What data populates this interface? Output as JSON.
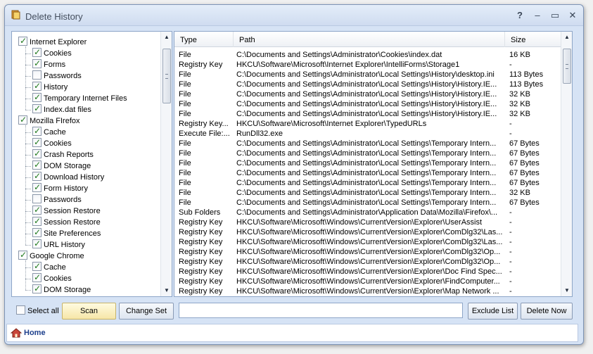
{
  "window": {
    "title": "Delete History"
  },
  "tree": [
    {
      "label": "Internet Explorer",
      "checked": true,
      "level": 0
    },
    {
      "label": "Cookies",
      "checked": true,
      "level": 1
    },
    {
      "label": "Forms",
      "checked": true,
      "level": 1
    },
    {
      "label": "Passwords",
      "checked": false,
      "level": 1
    },
    {
      "label": "History",
      "checked": true,
      "level": 1
    },
    {
      "label": "Temporary Internet Files",
      "checked": true,
      "level": 1
    },
    {
      "label": "Index.dat files",
      "checked": true,
      "level": 1
    },
    {
      "label": "Mozilla FIrefox",
      "checked": true,
      "level": 0
    },
    {
      "label": "Cache",
      "checked": true,
      "level": 1
    },
    {
      "label": "Cookies",
      "checked": true,
      "level": 1
    },
    {
      "label": "Crash Reports",
      "checked": true,
      "level": 1
    },
    {
      "label": "DOM Storage",
      "checked": true,
      "level": 1
    },
    {
      "label": "Download History",
      "checked": true,
      "level": 1
    },
    {
      "label": "Form History",
      "checked": true,
      "level": 1
    },
    {
      "label": "Passwords",
      "checked": false,
      "level": 1
    },
    {
      "label": "Session Restore",
      "checked": true,
      "level": 1
    },
    {
      "label": "Session Restore",
      "checked": true,
      "level": 1
    },
    {
      "label": "Site Preferences",
      "checked": true,
      "level": 1
    },
    {
      "label": "URL History",
      "checked": true,
      "level": 1
    },
    {
      "label": "Google Chrome",
      "checked": true,
      "level": 0
    },
    {
      "label": "Cache",
      "checked": true,
      "level": 1
    },
    {
      "label": "Cookies",
      "checked": true,
      "level": 1
    },
    {
      "label": "DOM Storage",
      "checked": true,
      "level": 1
    }
  ],
  "list": {
    "columns": [
      "Type",
      "Path",
      "Size"
    ],
    "rows": [
      [
        "File",
        "C:\\Documents and Settings\\Administrator\\Cookies\\index.dat",
        "16 KB"
      ],
      [
        "Registry Key",
        "HKCU\\Software\\Microsoft\\Internet Explorer\\IntelliForms\\Storage1",
        "-"
      ],
      [
        "File",
        "C:\\Documents and Settings\\Administrator\\Local Settings\\History\\desktop.ini",
        "113 Bytes"
      ],
      [
        "File",
        "C:\\Documents and Settings\\Administrator\\Local Settings\\History\\History.IE...",
        "113 Bytes"
      ],
      [
        "File",
        "C:\\Documents and Settings\\Administrator\\Local Settings\\History\\History.IE...",
        "32 KB"
      ],
      [
        "File",
        "C:\\Documents and Settings\\Administrator\\Local Settings\\History\\History.IE...",
        "32 KB"
      ],
      [
        "File",
        "C:\\Documents and Settings\\Administrator\\Local Settings\\History\\History.IE...",
        "32 KB"
      ],
      [
        "Registry Key...",
        "HKCU\\Software\\Microsoft\\Internet Explorer\\TypedURLs",
        "-"
      ],
      [
        "Execute File:...",
        "RunDll32.exe",
        "-"
      ],
      [
        "File",
        "C:\\Documents and Settings\\Administrator\\Local Settings\\Temporary Intern...",
        "67 Bytes"
      ],
      [
        "File",
        "C:\\Documents and Settings\\Administrator\\Local Settings\\Temporary Intern...",
        "67 Bytes"
      ],
      [
        "File",
        "C:\\Documents and Settings\\Administrator\\Local Settings\\Temporary Intern...",
        "67 Bytes"
      ],
      [
        "File",
        "C:\\Documents and Settings\\Administrator\\Local Settings\\Temporary Intern...",
        "67 Bytes"
      ],
      [
        "File",
        "C:\\Documents and Settings\\Administrator\\Local Settings\\Temporary Intern...",
        "67 Bytes"
      ],
      [
        "File",
        "C:\\Documents and Settings\\Administrator\\Local Settings\\Temporary Intern...",
        "32 KB"
      ],
      [
        "File",
        "C:\\Documents and Settings\\Administrator\\Local Settings\\Temporary Intern...",
        "67 Bytes"
      ],
      [
        "Sub Folders",
        "C:\\Documents and Settings\\Administrator\\Application Data\\Mozilla\\Firefox\\...",
        "-"
      ],
      [
        "Registry Key",
        "HKCU\\Software\\Microsoft\\Windows\\CurrentVersion\\Explorer\\UserAssist",
        "-"
      ],
      [
        "Registry Key",
        "HKCU\\Software\\Microsoft\\Windows\\CurrentVersion\\Explorer\\ComDlg32\\Las...",
        "-"
      ],
      [
        "Registry Key",
        "HKCU\\Software\\Microsoft\\Windows\\CurrentVersion\\Explorer\\ComDlg32\\Las...",
        "-"
      ],
      [
        "Registry Key",
        "HKCU\\Software\\Microsoft\\Windows\\CurrentVersion\\Explorer\\ComDlg32\\Op...",
        "-"
      ],
      [
        "Registry Key",
        "HKCU\\Software\\Microsoft\\Windows\\CurrentVersion\\Explorer\\ComDlg32\\Op...",
        "-"
      ],
      [
        "Registry Key",
        "HKCU\\Software\\Microsoft\\Windows\\CurrentVersion\\Explorer\\Doc Find Spec...",
        "-"
      ],
      [
        "Registry Key",
        "HKCU\\Software\\Microsoft\\Windows\\CurrentVersion\\Explorer\\FindComputer...",
        "-"
      ],
      [
        "Registry Key",
        "HKCU\\Software\\Microsoft\\Windows\\CurrentVersion\\Explorer\\Map Network ...",
        "-"
      ]
    ]
  },
  "toolbar": {
    "select_all_label": "Select all",
    "scan_label": "Scan",
    "change_set_label": "Change Set",
    "path_value": "",
    "exclude_list_label": "Exclude List",
    "delete_now_label": "Delete Now"
  },
  "status": {
    "home_label": "Home"
  },
  "icons": {
    "app": "app-broom-icon",
    "home": "home-icon",
    "help": "help-icon",
    "minimize": "minimize-icon",
    "maximize": "maximize-icon",
    "close": "close-icon"
  }
}
